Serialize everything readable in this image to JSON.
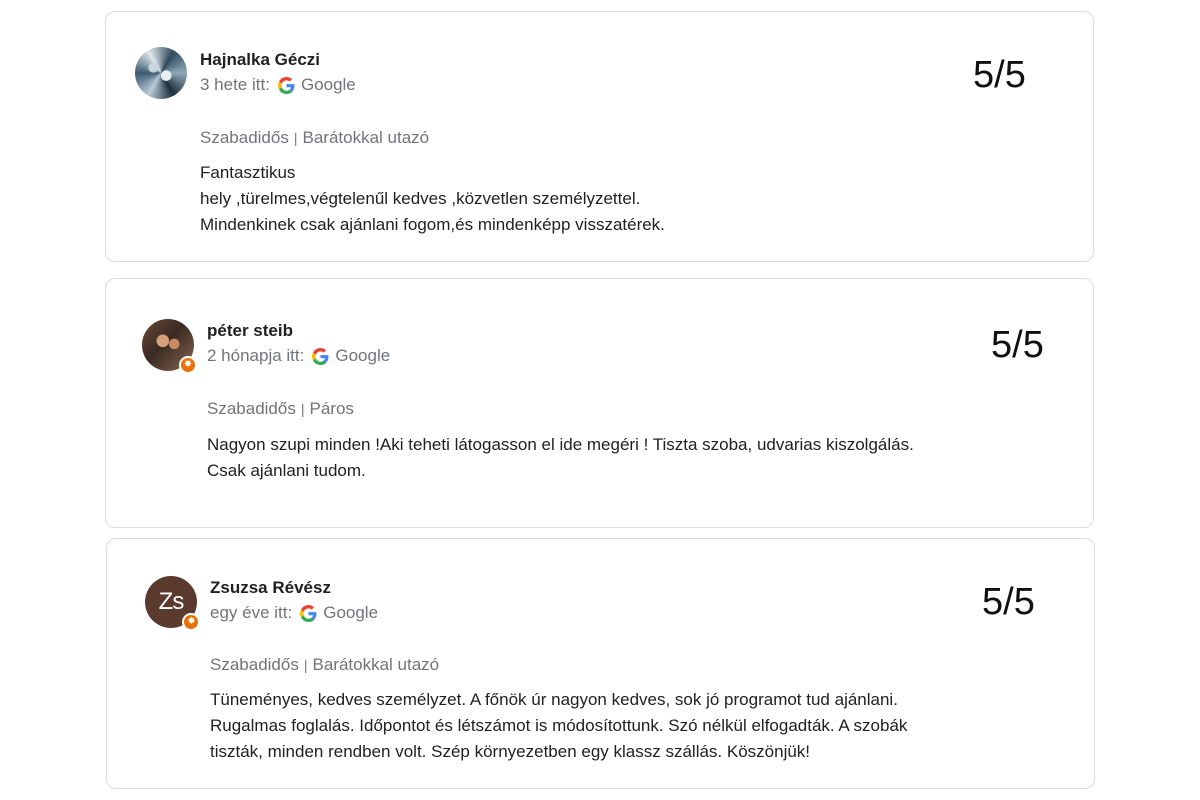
{
  "reviews": [
    {
      "name": "Hajnalka Géczi",
      "time": "3 hete itt:",
      "source": "Google",
      "score": "5/5",
      "tag1": "Szabadidős",
      "tag_separator": "|",
      "tag2": "Barátokkal utazó",
      "text": "Fantasztikus\nhely ,türelmes,végtelenűl kedves ,közvetlen személyzettel.\nMindenkinek csak ajánlani fogom,és mindenképp visszatérek.",
      "avatar_icon": "profile-photo",
      "local_guide_badge": false
    },
    {
      "name": "péter steib",
      "time": "2 hónapja itt:",
      "source": "Google",
      "score": "5/5",
      "tag1": "Szabadidős",
      "tag_separator": "|",
      "tag2": "Páros",
      "text": "Nagyon szupi minden !Aki teheti látogasson el ide megéri ! Tiszta szoba, udvarias kiszolgálás.\nCsak ajánlani tudom.",
      "avatar_icon": "profile-photo",
      "local_guide_badge": true
    },
    {
      "name": "Zsuzsa Révész",
      "time": "egy éve itt:",
      "source": "Google",
      "score": "5/5",
      "tag1": "Szabadidős",
      "tag_separator": "|",
      "tag2": "Barátokkal utazó",
      "text": "Tüneményes, kedves személyzet. A főnök úr nagyon kedves, sok jó programot tud ajánlani.\nRugalmas foglalás. Időpontot és létszámot is módosítottunk. Szó nélkül elfogadták. A szobák\ntiszták, minden rendben volt. Szép környezetben egy klassz szállás. Köszönjük!",
      "avatar_initials": "Zs",
      "avatar_color": "#5b3a2e",
      "local_guide_badge": true
    }
  ],
  "badge_icon": "local-guide-star-icon",
  "source_icon": "google-g-icon",
  "badge_color": "#e8710a"
}
